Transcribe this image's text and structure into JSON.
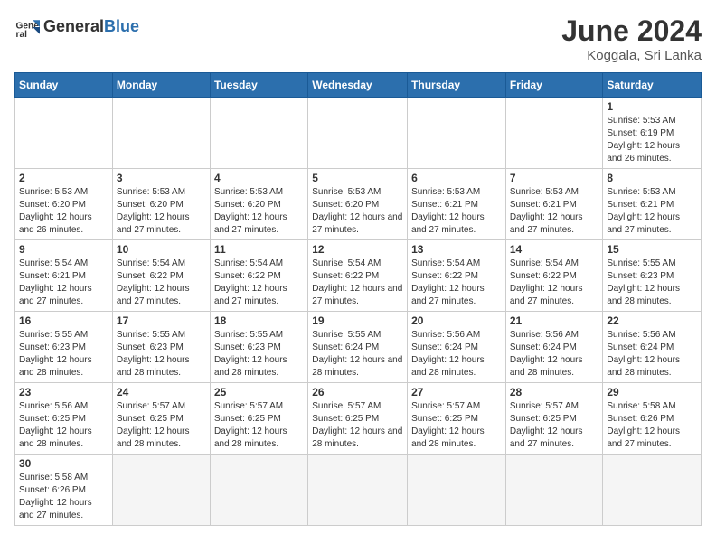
{
  "header": {
    "logo_general": "General",
    "logo_blue": "Blue",
    "month_year": "June 2024",
    "location": "Koggala, Sri Lanka"
  },
  "weekdays": [
    "Sunday",
    "Monday",
    "Tuesday",
    "Wednesday",
    "Thursday",
    "Friday",
    "Saturday"
  ],
  "weeks": [
    [
      {
        "day": "",
        "info": ""
      },
      {
        "day": "",
        "info": ""
      },
      {
        "day": "",
        "info": ""
      },
      {
        "day": "",
        "info": ""
      },
      {
        "day": "",
        "info": ""
      },
      {
        "day": "",
        "info": ""
      },
      {
        "day": "1",
        "info": "Sunrise: 5:53 AM\nSunset: 6:19 PM\nDaylight: 12 hours and 26 minutes."
      }
    ],
    [
      {
        "day": "2",
        "info": "Sunrise: 5:53 AM\nSunset: 6:20 PM\nDaylight: 12 hours and 26 minutes."
      },
      {
        "day": "3",
        "info": "Sunrise: 5:53 AM\nSunset: 6:20 PM\nDaylight: 12 hours and 27 minutes."
      },
      {
        "day": "4",
        "info": "Sunrise: 5:53 AM\nSunset: 6:20 PM\nDaylight: 12 hours and 27 minutes."
      },
      {
        "day": "5",
        "info": "Sunrise: 5:53 AM\nSunset: 6:20 PM\nDaylight: 12 hours and 27 minutes."
      },
      {
        "day": "6",
        "info": "Sunrise: 5:53 AM\nSunset: 6:21 PM\nDaylight: 12 hours and 27 minutes."
      },
      {
        "day": "7",
        "info": "Sunrise: 5:53 AM\nSunset: 6:21 PM\nDaylight: 12 hours and 27 minutes."
      },
      {
        "day": "8",
        "info": "Sunrise: 5:53 AM\nSunset: 6:21 PM\nDaylight: 12 hours and 27 minutes."
      }
    ],
    [
      {
        "day": "9",
        "info": "Sunrise: 5:54 AM\nSunset: 6:21 PM\nDaylight: 12 hours and 27 minutes."
      },
      {
        "day": "10",
        "info": "Sunrise: 5:54 AM\nSunset: 6:22 PM\nDaylight: 12 hours and 27 minutes."
      },
      {
        "day": "11",
        "info": "Sunrise: 5:54 AM\nSunset: 6:22 PM\nDaylight: 12 hours and 27 minutes."
      },
      {
        "day": "12",
        "info": "Sunrise: 5:54 AM\nSunset: 6:22 PM\nDaylight: 12 hours and 27 minutes."
      },
      {
        "day": "13",
        "info": "Sunrise: 5:54 AM\nSunset: 6:22 PM\nDaylight: 12 hours and 27 minutes."
      },
      {
        "day": "14",
        "info": "Sunrise: 5:54 AM\nSunset: 6:22 PM\nDaylight: 12 hours and 27 minutes."
      },
      {
        "day": "15",
        "info": "Sunrise: 5:55 AM\nSunset: 6:23 PM\nDaylight: 12 hours and 28 minutes."
      }
    ],
    [
      {
        "day": "16",
        "info": "Sunrise: 5:55 AM\nSunset: 6:23 PM\nDaylight: 12 hours and 28 minutes."
      },
      {
        "day": "17",
        "info": "Sunrise: 5:55 AM\nSunset: 6:23 PM\nDaylight: 12 hours and 28 minutes."
      },
      {
        "day": "18",
        "info": "Sunrise: 5:55 AM\nSunset: 6:23 PM\nDaylight: 12 hours and 28 minutes."
      },
      {
        "day": "19",
        "info": "Sunrise: 5:55 AM\nSunset: 6:24 PM\nDaylight: 12 hours and 28 minutes."
      },
      {
        "day": "20",
        "info": "Sunrise: 5:56 AM\nSunset: 6:24 PM\nDaylight: 12 hours and 28 minutes."
      },
      {
        "day": "21",
        "info": "Sunrise: 5:56 AM\nSunset: 6:24 PM\nDaylight: 12 hours and 28 minutes."
      },
      {
        "day": "22",
        "info": "Sunrise: 5:56 AM\nSunset: 6:24 PM\nDaylight: 12 hours and 28 minutes."
      }
    ],
    [
      {
        "day": "23",
        "info": "Sunrise: 5:56 AM\nSunset: 6:25 PM\nDaylight: 12 hours and 28 minutes."
      },
      {
        "day": "24",
        "info": "Sunrise: 5:57 AM\nSunset: 6:25 PM\nDaylight: 12 hours and 28 minutes."
      },
      {
        "day": "25",
        "info": "Sunrise: 5:57 AM\nSunset: 6:25 PM\nDaylight: 12 hours and 28 minutes."
      },
      {
        "day": "26",
        "info": "Sunrise: 5:57 AM\nSunset: 6:25 PM\nDaylight: 12 hours and 28 minutes."
      },
      {
        "day": "27",
        "info": "Sunrise: 5:57 AM\nSunset: 6:25 PM\nDaylight: 12 hours and 28 minutes."
      },
      {
        "day": "28",
        "info": "Sunrise: 5:57 AM\nSunset: 6:25 PM\nDaylight: 12 hours and 27 minutes."
      },
      {
        "day": "29",
        "info": "Sunrise: 5:58 AM\nSunset: 6:26 PM\nDaylight: 12 hours and 27 minutes."
      }
    ],
    [
      {
        "day": "30",
        "info": "Sunrise: 5:58 AM\nSunset: 6:26 PM\nDaylight: 12 hours and 27 minutes."
      },
      {
        "day": "",
        "info": ""
      },
      {
        "day": "",
        "info": ""
      },
      {
        "day": "",
        "info": ""
      },
      {
        "day": "",
        "info": ""
      },
      {
        "day": "",
        "info": ""
      },
      {
        "day": "",
        "info": ""
      }
    ]
  ]
}
